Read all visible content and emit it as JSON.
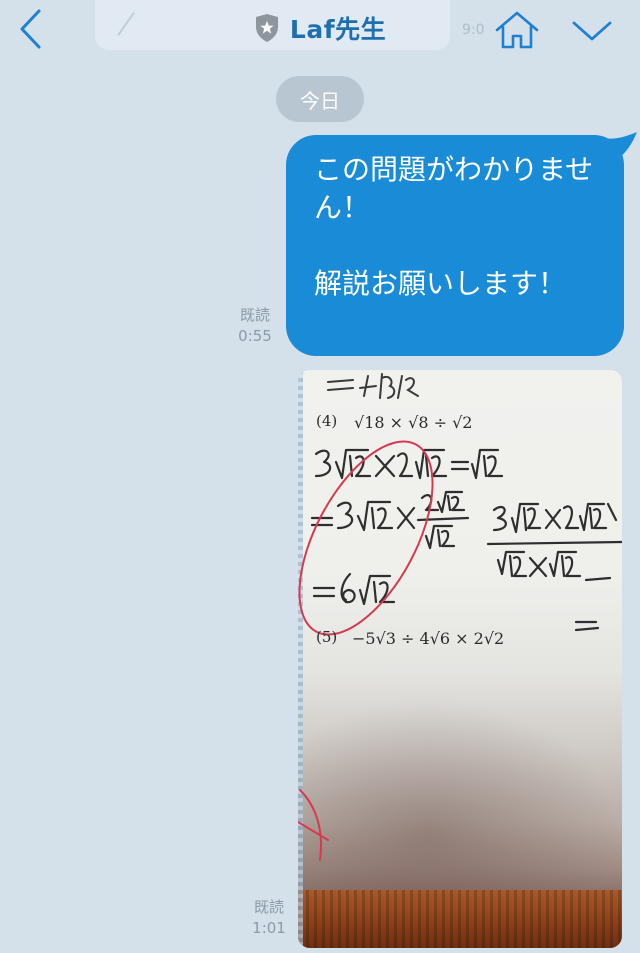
{
  "header": {
    "title": "Laf先生",
    "back_icon": "chevron-left-icon",
    "badge_icon": "shield-star-icon",
    "home_icon": "home-icon",
    "menu_icon": "chevron-down-icon",
    "accent_color": "#1f7fd0"
  },
  "chat": {
    "date_label": "今日",
    "messages": [
      {
        "type": "text",
        "text": "この問題がわかりません！\n\n解説お願いします！",
        "read_label": "既読",
        "time": "0:55",
        "bubble_color": "#1a8cd7"
      },
      {
        "type": "image",
        "read_label": "既読",
        "time": "1:01",
        "image": {
          "problem_4_number": "(4)",
          "problem_4": "√18 × √8 ÷ √2",
          "problem_5_number": "(5)",
          "problem_5": "−5√3 ÷ 4√6 × 2√2"
        }
      }
    ]
  }
}
